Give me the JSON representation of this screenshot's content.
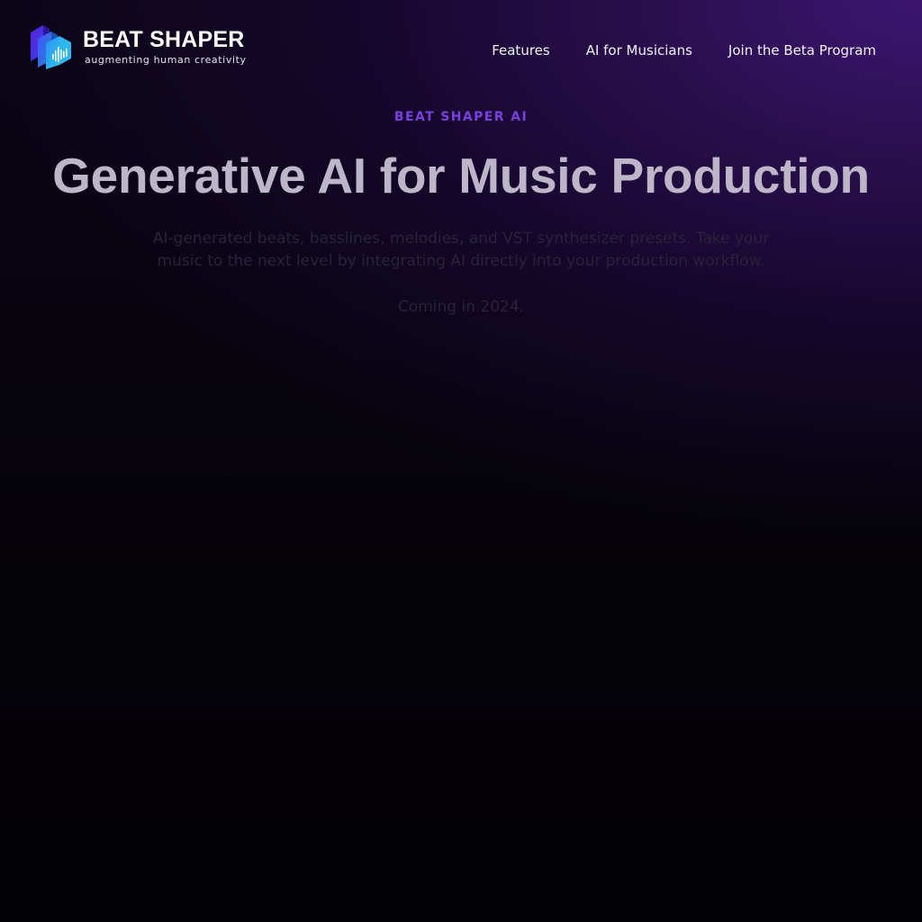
{
  "header": {
    "brand": {
      "name": "BEAT SHAPER",
      "tagline": "augmenting human creativity",
      "logo_icon": "beat-shaper-logo-icon"
    },
    "nav": [
      {
        "label": "Features"
      },
      {
        "label": "AI for Musicians"
      },
      {
        "label": "Join the Beta Program"
      }
    ]
  },
  "hero": {
    "eyebrow": "BEAT SHAPER AI",
    "headline": "Generative AI for Music Production",
    "description": "AI-generated beats, basslines, melodies, and VST synthesizer presets. Take your music to the next level by integrating AI directly into your production workflow.",
    "coming_soon": "Coming in 2024."
  },
  "colors": {
    "accent": "#7a3fe0",
    "background": "#030208",
    "glow": "#3d1570",
    "logo_gradient_start": "#5b2de0",
    "logo_gradient_end": "#2ec5f0"
  }
}
